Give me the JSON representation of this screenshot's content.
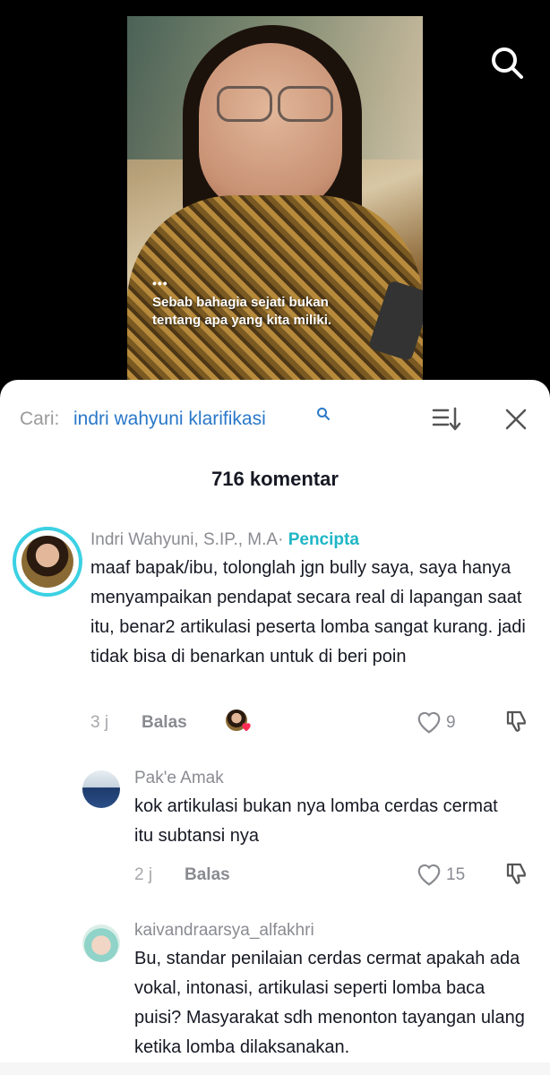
{
  "video": {
    "dots": "•••",
    "caption": "Sebab bahagia sejati bukan tentang apa yang kita miliki."
  },
  "icons": {
    "search": "search-icon",
    "sort": "sort-icon",
    "close": "close-icon",
    "like": "heart-icon",
    "dislike": "thumbs-down-icon"
  },
  "panel": {
    "search_label": "Cari:",
    "search_query": "indri wahyuni klarifikasi",
    "count_label": "716 komentar"
  },
  "comments": [
    {
      "author": "Indri Wahyuni, S.IP., M.A",
      "separator": "·",
      "badge": "Pencipta",
      "text": "maaf bapak/ibu, tolonglah jgn bully saya, saya hanya menyampaikan pendapat secara real di lapangan saat itu, benar2 artikulasi peserta lomba sangat kurang. jadi tidak bisa di benarkan untuk di beri poin",
      "time": "3 j",
      "reply_label": "Balas",
      "likes": "9"
    },
    {
      "author": "Pak'e Amak",
      "text": "kok artikulasi bukan nya lomba cerdas cermat itu subtansi nya",
      "time": "2 j",
      "reply_label": "Balas",
      "likes": "15"
    },
    {
      "author": "kaivandraarsya_alfakhri",
      "text": "Bu, standar penilaian cerdas cermat apakah ada vokal, intonasi, artikulasi seperti lomba baca puisi? Masyarakat sdh menonton tayangan ulang ketika lomba dilaksanakan."
    }
  ],
  "colors": {
    "accent": "#2a78c9",
    "creator_badge": "#1fb6c6",
    "like_pink": "#fe2c55"
  }
}
